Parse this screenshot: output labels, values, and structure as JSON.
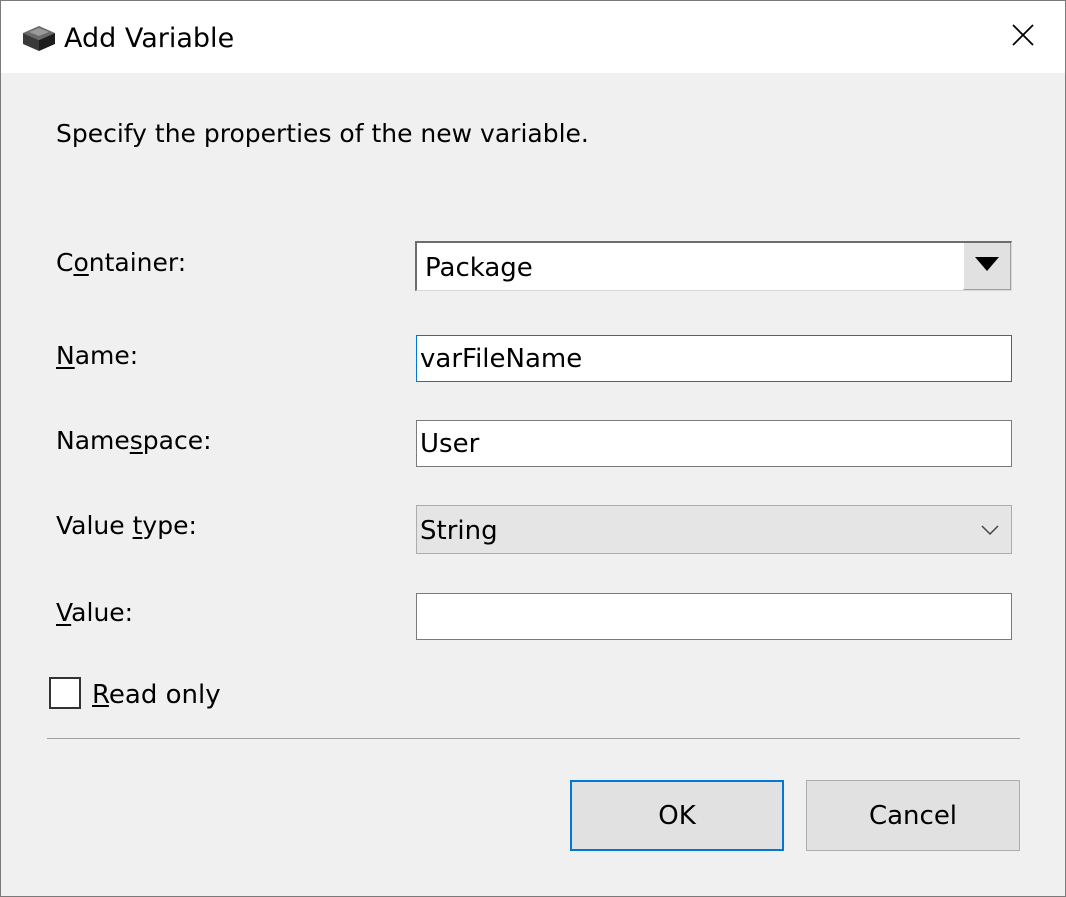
{
  "window": {
    "title": "Add Variable",
    "icon": "cube-icon",
    "close_icon": "close-icon"
  },
  "prompt": "Specify the properties of the new variable.",
  "fields": {
    "container": {
      "label_pre": "C",
      "label_accel": "o",
      "label_post": "ntainer:",
      "value": "Package"
    },
    "name": {
      "label_pre": "",
      "label_accel": "N",
      "label_post": "ame:",
      "value": "varFileName"
    },
    "namespace": {
      "label_pre": "Name",
      "label_accel": "s",
      "label_post": "pace:",
      "value": "User"
    },
    "value_type": {
      "label_pre": "Value ",
      "label_accel": "t",
      "label_post": "ype:",
      "value": "String"
    },
    "value": {
      "label_pre": "",
      "label_accel": "V",
      "label_post": "alue:",
      "value": ""
    }
  },
  "read_only": {
    "label_accel": "R",
    "label_post": "ead only",
    "checked": false
  },
  "buttons": {
    "ok": "OK",
    "cancel": "Cancel"
  },
  "colors": {
    "dialog_bg": "#f0f0f0",
    "focus_accent": "#0078d7"
  }
}
